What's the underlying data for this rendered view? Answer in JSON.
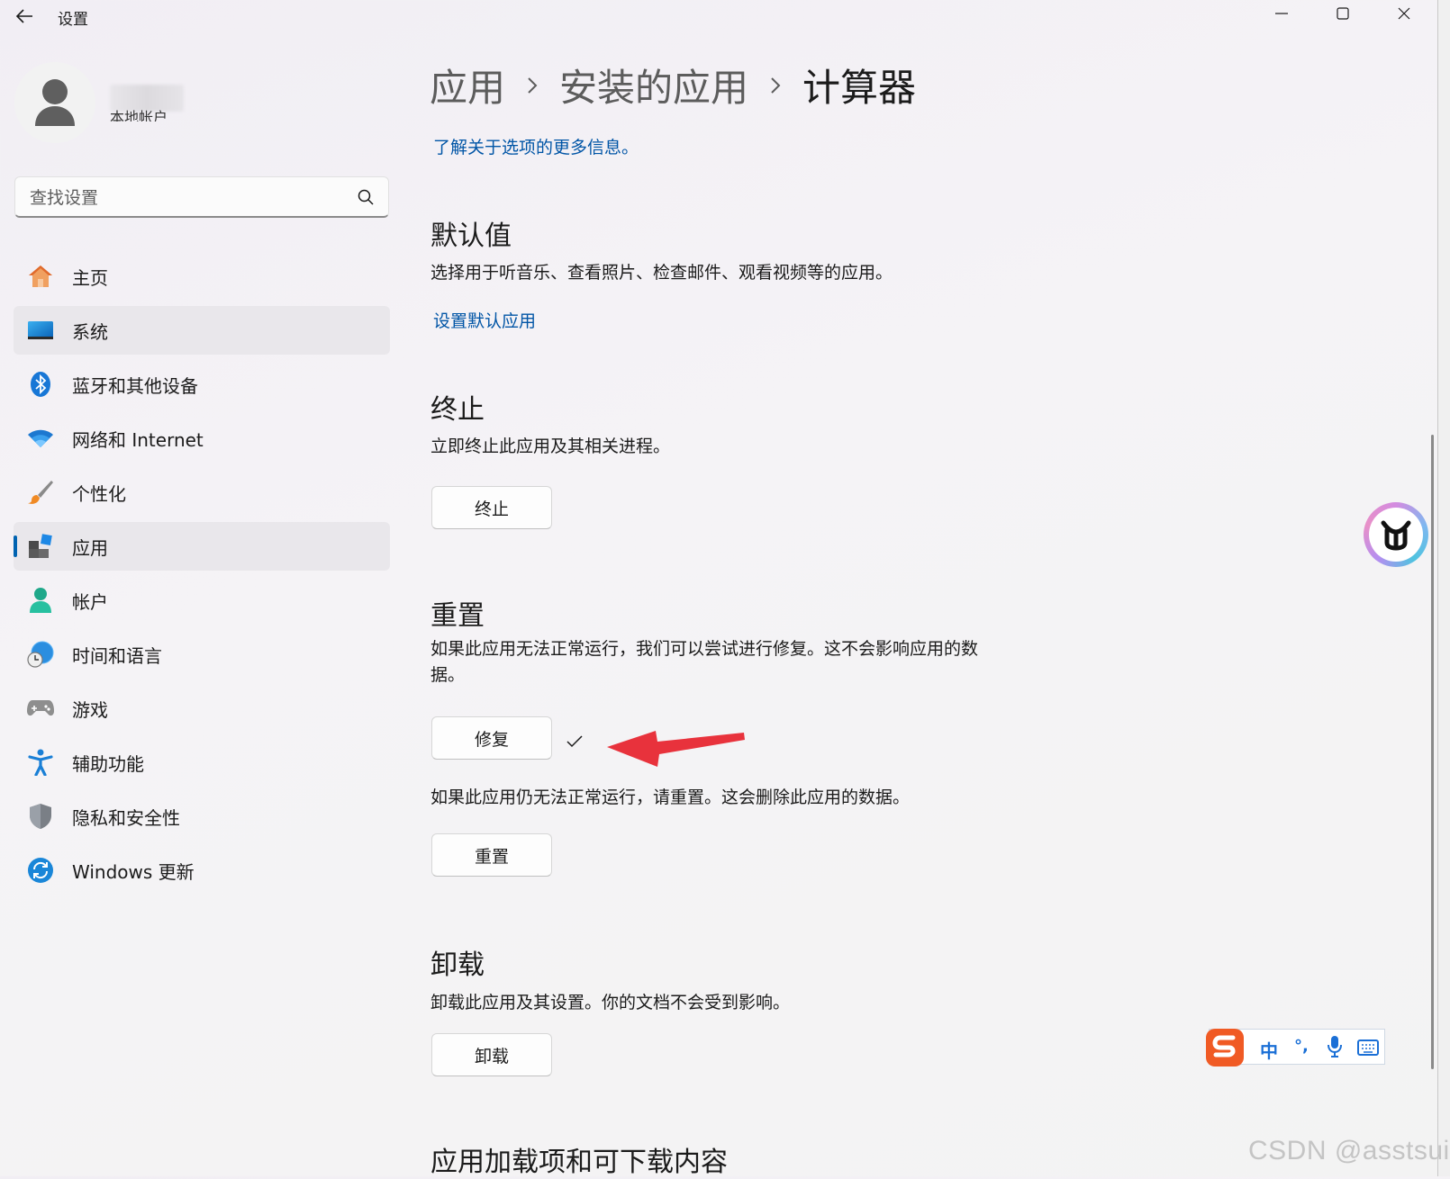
{
  "window": {
    "title": "设置",
    "controls": [
      "minimize-icon",
      "maximize-icon",
      "close-icon"
    ]
  },
  "account": {
    "type": "本地帐户"
  },
  "search": {
    "placeholder": "查找设置",
    "value": ""
  },
  "sidebar": {
    "items": [
      {
        "label": "主页",
        "icon": "home-icon"
      },
      {
        "label": "系统",
        "icon": "system-icon",
        "state": "hovered"
      },
      {
        "label": "蓝牙和其他设备",
        "icon": "bluetooth-icon"
      },
      {
        "label": "网络和 Internet",
        "icon": "wifi-icon"
      },
      {
        "label": "个性化",
        "icon": "brush-icon"
      },
      {
        "label": "应用",
        "icon": "apps-icon",
        "state": "selected"
      },
      {
        "label": "帐户",
        "icon": "account-icon"
      },
      {
        "label": "时间和语言",
        "icon": "time-language-icon"
      },
      {
        "label": "游戏",
        "icon": "gamepad-icon"
      },
      {
        "label": "辅助功能",
        "icon": "accessibility-icon"
      },
      {
        "label": "隐私和安全性",
        "icon": "shield-icon"
      },
      {
        "label": "Windows 更新",
        "icon": "update-icon"
      }
    ]
  },
  "breadcrumb": [
    "应用",
    "安装的应用",
    "计算器"
  ],
  "main": {
    "learn_more": "了解关于选项的更多信息。",
    "defaults": {
      "title": "默认值",
      "desc": "选择用于听音乐、查看照片、检查邮件、观看视频等的应用。",
      "link": "设置默认应用"
    },
    "terminate": {
      "title": "终止",
      "desc": "立即终止此应用及其相关进程。",
      "button": "终止"
    },
    "reset": {
      "title": "重置",
      "desc_line1": "如果此应用无法正常运行，我们可以尝试进行修复。这不会影响应用的数",
      "desc_line2": "据。",
      "repair_button": "修复",
      "repair_status": "check-icon",
      "reset_desc": "如果此应用仍无法正常运行，请重置。这会删除此应用的数据。",
      "reset_button": "重置"
    },
    "uninstall": {
      "title": "卸载",
      "desc": "卸载此应用及其设置。你的文档不会受到影响。",
      "button": "卸载"
    },
    "addons": {
      "title": "应用加载项和可下载内容"
    }
  },
  "ime": {
    "mode": "中",
    "punct": "°,"
  },
  "watermark": "CSDN @asstsui",
  "colors": {
    "accent": "#0063b1",
    "link": "#0055a6",
    "annotation_arrow": "#e8323c"
  }
}
